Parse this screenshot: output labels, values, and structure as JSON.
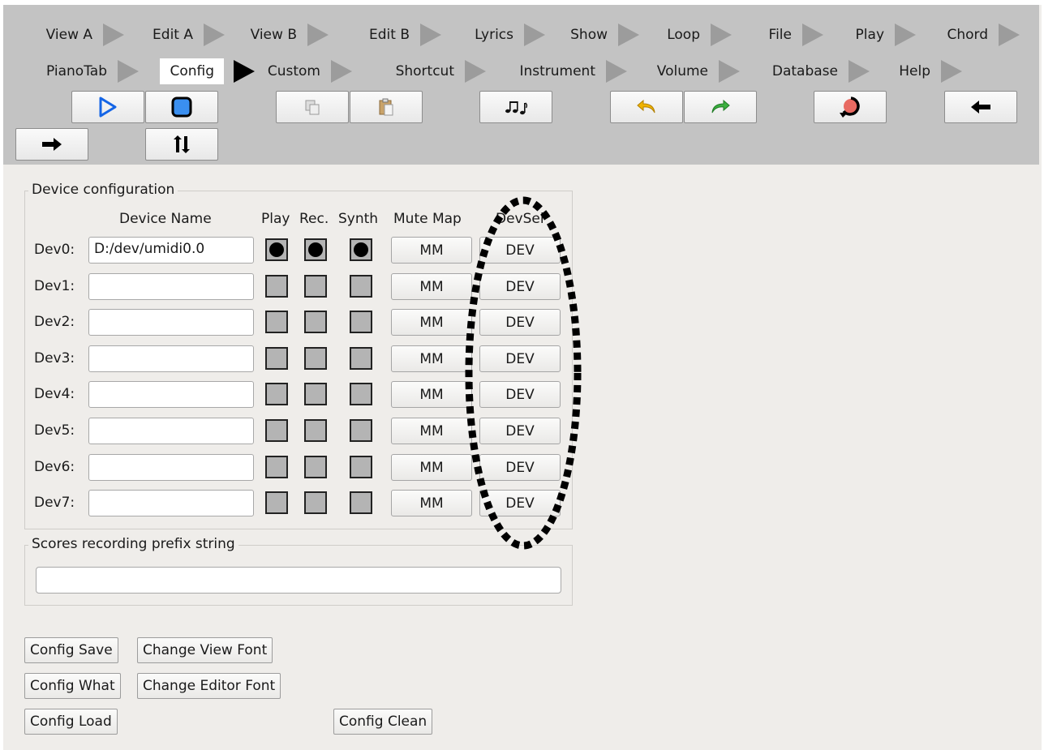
{
  "menu_tabs": [
    {
      "label": "View A"
    },
    {
      "label": "Edit A"
    },
    {
      "label": "View B"
    },
    {
      "label": "Edit B"
    },
    {
      "label": "Lyrics"
    },
    {
      "label": "Show"
    },
    {
      "label": "Loop"
    },
    {
      "label": "File"
    },
    {
      "label": "Play"
    },
    {
      "label": "Chord"
    },
    {
      "label": "PianoTab"
    },
    {
      "label": "Config",
      "active": true
    },
    {
      "label": "Custom"
    },
    {
      "label": "Shortcut"
    },
    {
      "label": "Instrument"
    },
    {
      "label": "Volume"
    },
    {
      "label": "Database"
    },
    {
      "label": "Help"
    }
  ],
  "tool_buttons": [
    {
      "icon": "play-icon"
    },
    {
      "icon": "stop-icon"
    },
    {
      "icon": "copy-icon"
    },
    {
      "icon": "paste-icon"
    },
    {
      "icon": "music-notes-icon"
    },
    {
      "icon": "undo-icon"
    },
    {
      "icon": "redo-icon"
    },
    {
      "icon": "reload-icon"
    },
    {
      "icon": "arrow-left-icon"
    },
    {
      "icon": "arrow-right-icon"
    },
    {
      "icon": "swap-arrows-icon"
    }
  ],
  "device_config": {
    "title": "Device configuration",
    "headers": {
      "name": "Device Name",
      "play": "Play",
      "rec": "Rec.",
      "synth": "Synth",
      "mute": "Mute Map",
      "devsel": "DevSel"
    },
    "rows": [
      {
        "label": "Dev0:",
        "value": "D:/dev/umidi0.0",
        "play": true,
        "rec": true,
        "synth": true,
        "mm": "MM",
        "dev": "DEV"
      },
      {
        "label": "Dev1:",
        "value": "",
        "play": false,
        "rec": false,
        "synth": false,
        "mm": "MM",
        "dev": "DEV"
      },
      {
        "label": "Dev2:",
        "value": "",
        "play": false,
        "rec": false,
        "synth": false,
        "mm": "MM",
        "dev": "DEV"
      },
      {
        "label": "Dev3:",
        "value": "",
        "play": false,
        "rec": false,
        "synth": false,
        "mm": "MM",
        "dev": "DEV"
      },
      {
        "label": "Dev4:",
        "value": "",
        "play": false,
        "rec": false,
        "synth": false,
        "mm": "MM",
        "dev": "DEV"
      },
      {
        "label": "Dev5:",
        "value": "",
        "play": false,
        "rec": false,
        "synth": false,
        "mm": "MM",
        "dev": "DEV"
      },
      {
        "label": "Dev6:",
        "value": "",
        "play": false,
        "rec": false,
        "synth": false,
        "mm": "MM",
        "dev": "DEV"
      },
      {
        "label": "Dev7:",
        "value": "",
        "play": false,
        "rec": false,
        "synth": false,
        "mm": "MM",
        "dev": "DEV"
      }
    ]
  },
  "prefix": {
    "title": "Scores recording prefix string",
    "value": ""
  },
  "bottom_buttons": {
    "config_save": "Config Save",
    "change_view_font": "Change View Font",
    "config_what": "Config What",
    "change_editor_font": "Change Editor Font",
    "config_load": "Config Load",
    "config_clean": "Config Clean"
  },
  "colors": {
    "toolbar": "#c3c3c3",
    "panel": "#efedea",
    "play": "#1565e6",
    "stop": "#3a8ff0",
    "undo": "#f0b400",
    "redo": "#3cb040",
    "reload": "#e86a62"
  }
}
